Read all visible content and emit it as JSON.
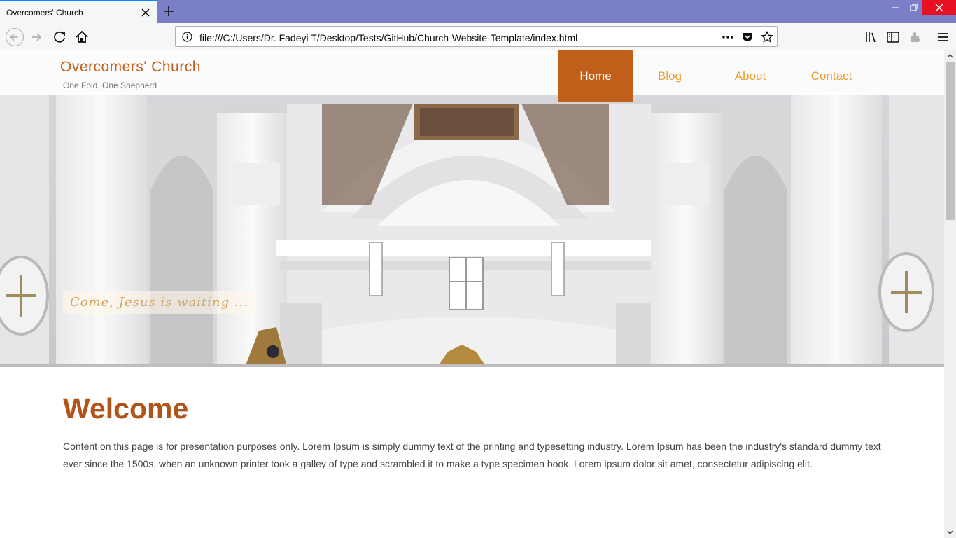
{
  "browser": {
    "tab_title": "Overcomers' Church",
    "url": "file:///C:/Users/Dr. Fadeyi T/Desktop/Tests/GitHub/Church-Website-Template/index.html",
    "accent": "#0a84ff",
    "titlebar_color": "#7a7fc8"
  },
  "site": {
    "title": "Overcomers' Church",
    "tagline": "One Fold, One Shepherd",
    "nav": [
      {
        "label": "Home",
        "active": true
      },
      {
        "label": "Blog",
        "active": false
      },
      {
        "label": "About",
        "active": false
      },
      {
        "label": "Contact",
        "active": false
      }
    ],
    "brand_color": "#c0601a",
    "link_color": "#e8a030"
  },
  "hero": {
    "caption": "Come, Jesus is waiting ..."
  },
  "main": {
    "heading": "Welcome",
    "paragraph": "Content on this page is for presentation purposes only. Lorem Ipsum is simply dummy text of the printing and typesetting industry. Lorem Ipsum has been the industry's standard dummy text ever since the 1500s, when an unknown printer took a galley of type and scrambled it to make a type specimen book. Lorem ipsum dolor sit amet, consectetur adipiscing elit."
  }
}
